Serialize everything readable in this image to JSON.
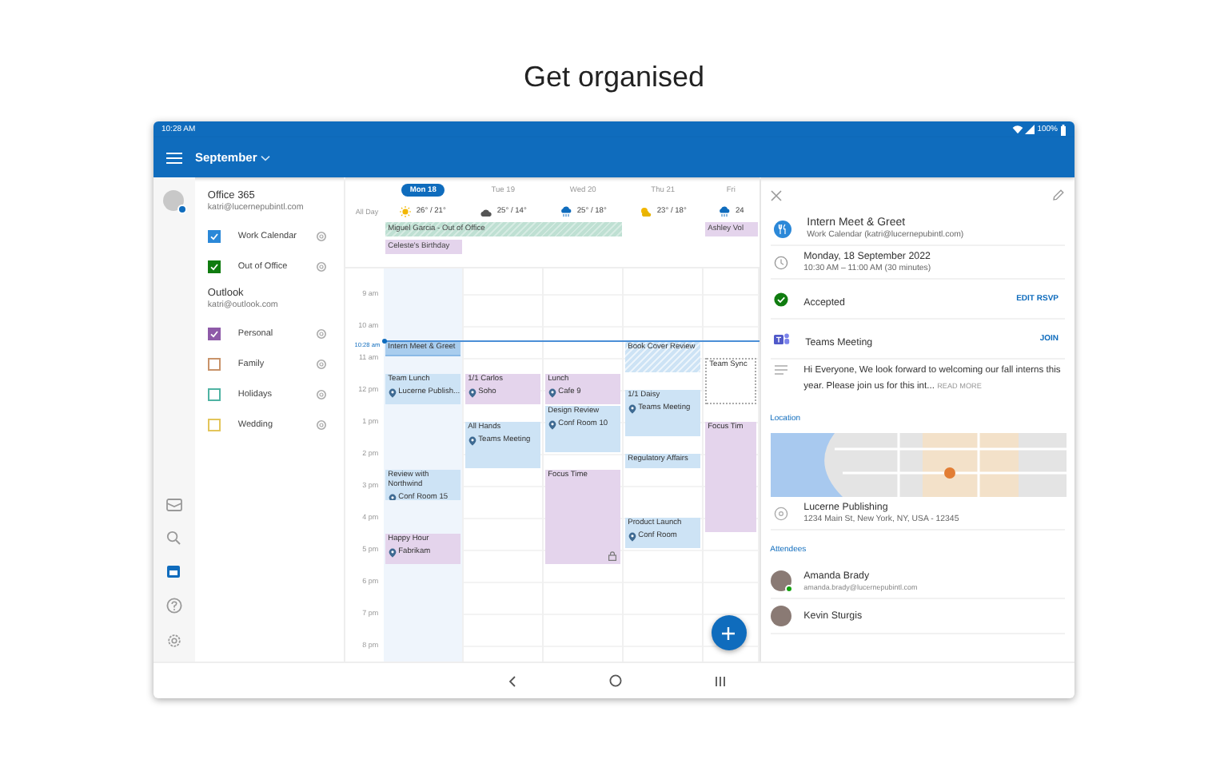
{
  "heading": "Get organised",
  "status_bar": {
    "time": "10:28 AM",
    "battery": "100%"
  },
  "app_bar": {
    "title": "September"
  },
  "accounts": [
    {
      "name": "Office 365",
      "email": "katri@lucernepubintl.com",
      "calendars": [
        {
          "name": "Work Calendar",
          "checked": true,
          "color": "#2b88d8"
        },
        {
          "name": "Out of Office",
          "checked": true,
          "color": "#107c10"
        }
      ]
    },
    {
      "name": "Outlook",
      "email": "katri@outlook.com",
      "calendars": [
        {
          "name": "Personal",
          "checked": true,
          "color": "#8e5aa8"
        },
        {
          "name": "Family",
          "checked": false,
          "color": "#c8936a"
        },
        {
          "name": "Holidays",
          "checked": false,
          "color": "#4fb3a3"
        },
        {
          "name": "Wedding",
          "checked": false,
          "color": "#e3c55a"
        }
      ]
    }
  ],
  "nav_rail": [
    {
      "kind": "mail",
      "selected": false
    },
    {
      "kind": "search",
      "selected": false
    },
    {
      "kind": "calendar",
      "selected": true
    },
    {
      "kind": "help",
      "selected": false
    },
    {
      "kind": "settings",
      "selected": false
    }
  ],
  "calendar": {
    "all_day_label": "All Day",
    "hours": [
      "9 am",
      "10 am",
      "11 am",
      "12 pm",
      "1 pm",
      "2 pm",
      "3 pm",
      "4 pm",
      "5 pm",
      "6 pm",
      "7 pm",
      "8 pm"
    ],
    "now_label": "10:28 am",
    "days": [
      {
        "label": "Mon 18",
        "selected": true,
        "weather": "26° / 21°",
        "all_day": [
          {
            "title": "Miguel Garcia - Out of Office",
            "kind": "out-of-office",
            "color": "#bfe0d3"
          },
          {
            "title": "Celeste's Birthday",
            "kind": "normal",
            "color": "#e4d4ec"
          }
        ],
        "events": [
          {
            "title": "Intern Meet & Greet",
            "kind": "selected",
            "color": "#a9cdee"
          },
          {
            "title": "Team Lunch",
            "location": "Lucerne Publish...",
            "kind": "normal",
            "color": "#cde3f5"
          },
          {
            "title": "Review with Northwind",
            "location": "Conf Room 15",
            "kind": "normal",
            "color": "#cde3f5"
          },
          {
            "title": "Happy Hour",
            "location": "Fabrikam",
            "kind": "normal",
            "color": "#e4d4ec"
          }
        ]
      },
      {
        "label": "Tue 19",
        "selected": false,
        "weather": "25° / 14°",
        "events": [
          {
            "title": "1/1 Carlos",
            "location": "Soho",
            "kind": "normal",
            "color": "#e4d4ec"
          },
          {
            "title": "All Hands",
            "location": "Teams Meeting",
            "kind": "normal",
            "color": "#cde3f5"
          }
        ]
      },
      {
        "label": "Wed 20",
        "selected": false,
        "weather": "25° / 18°",
        "events": [
          {
            "title": "Lunch",
            "location": "Cafe 9",
            "kind": "normal",
            "color": "#e4d4ec"
          },
          {
            "title": "Design Review",
            "location": "Conf Room 10",
            "kind": "normal",
            "color": "#cde3f5"
          },
          {
            "title": "Focus Time",
            "kind": "private",
            "color": "#e4d4ec"
          }
        ]
      },
      {
        "label": "Thu 21",
        "selected": false,
        "weather": "23° / 18°",
        "events": [
          {
            "title": "Book Cover Review",
            "kind": "tentative",
            "color": "#cde3f5"
          },
          {
            "title": "1/1 Daisy",
            "location": "Teams Meeting",
            "kind": "normal",
            "color": "#cde3f5"
          },
          {
            "title": "Regulatory Affairs",
            "kind": "normal",
            "color": "#cde3f5"
          },
          {
            "title": "Product Launch",
            "location": "Conf Room",
            "kind": "normal",
            "color": "#cde3f5"
          }
        ]
      },
      {
        "label": "Fri",
        "selected": false,
        "weather": "24",
        "all_day": [
          {
            "title": "Ashley Vol",
            "kind": "normal",
            "color": "#e4d4ec"
          }
        ],
        "events": [
          {
            "title": "Team Sync",
            "kind": "free",
            "color": "#ffffff"
          },
          {
            "title": "Focus Tim",
            "kind": "normal",
            "color": "#e4d4ec"
          }
        ]
      }
    ]
  },
  "detail": {
    "title": "Intern Meet & Greet",
    "calendar": "Work Calendar (katri@lucernepubintl.com)",
    "date": "Monday, 18 September 2022",
    "time": "10:30 AM – 11:00 AM (30 minutes)",
    "response": "Accepted",
    "response_action": "EDIT RSVP",
    "meeting": "Teams Meeting",
    "meeting_action": "JOIN",
    "notes": "Hi Everyone, We look forward to welcoming our fall interns this year. Please join us for this int...",
    "notes_action": "READ MORE",
    "location_heading": "Location",
    "location_name": "Lucerne Publishing",
    "location_address": "1234 Main St, New York, NY, USA - 12345",
    "attendees_heading": "Attendees",
    "attendees": [
      {
        "name": "Amanda Brady",
        "email": "amanda.brady@lucernepubintl.com",
        "accepted": true
      },
      {
        "name": "Kevin Sturgis",
        "accepted": false
      }
    ]
  }
}
